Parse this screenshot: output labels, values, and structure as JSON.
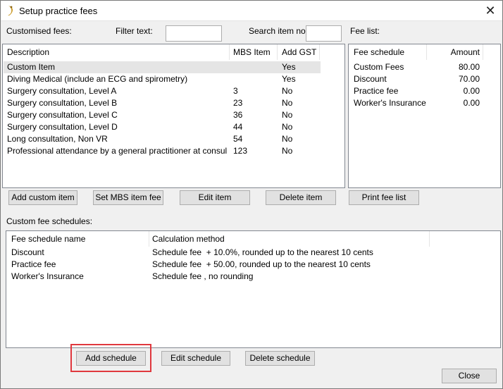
{
  "window": {
    "title": "Setup practice fees",
    "close_glyph": "✕",
    "icon": "practice-logo-icon"
  },
  "filters": {
    "customised_fees_label": "Customised fees:",
    "filter_text_label": "Filter text:",
    "filter_text_value": "",
    "search_item_label": "Search item no:",
    "search_item_value": "",
    "fee_list_label": "Fee list:"
  },
  "items_table": {
    "headers": {
      "description": "Description",
      "mbs_item": "MBS Item",
      "add_gst": "Add GST"
    },
    "rows": [
      {
        "description": "Custom Item",
        "mbs_item": "",
        "add_gst": "Yes"
      },
      {
        "description": "Diving Medical (include an ECG and spirometry)",
        "mbs_item": "",
        "add_gst": "Yes"
      },
      {
        "description": "Surgery consultation, Level A",
        "mbs_item": "3",
        "add_gst": "No"
      },
      {
        "description": "Surgery consultation, Level B",
        "mbs_item": "23",
        "add_gst": "No"
      },
      {
        "description": "Surgery consultation, Level C",
        "mbs_item": "36",
        "add_gst": "No"
      },
      {
        "description": "Surgery consultation, Level D",
        "mbs_item": "44",
        "add_gst": "No"
      },
      {
        "description": "Long consultation, Non VR",
        "mbs_item": "54",
        "add_gst": "No"
      },
      {
        "description": "Professional attendance by a general practitioner at consulting r...",
        "mbs_item": "123",
        "add_gst": "No"
      }
    ]
  },
  "fee_table": {
    "headers": {
      "schedule": "Fee schedule",
      "amount": "Amount"
    },
    "rows": [
      {
        "schedule": "Custom Fees",
        "amount": "80.00"
      },
      {
        "schedule": "Discount",
        "amount": "70.00"
      },
      {
        "schedule": "Practice fee",
        "amount": "0.00"
      },
      {
        "schedule": "Worker's Insurance",
        "amount": "0.00"
      }
    ]
  },
  "item_buttons": {
    "add_custom_item": "Add custom item",
    "set_mbs_item_fee": "Set MBS item fee",
    "edit_item": "Edit item",
    "delete_item": "Delete item",
    "print_fee_list": "Print fee list"
  },
  "schedules": {
    "label": "Custom fee schedules:",
    "headers": {
      "name": "Fee schedule name",
      "method": "Calculation method"
    },
    "rows": [
      {
        "name": "Discount",
        "method": "Schedule fee  + 10.0%, rounded up to the nearest 10 cents"
      },
      {
        "name": "Practice fee",
        "method": "Schedule fee  + 50.00, rounded up to the nearest 10 cents"
      },
      {
        "name": "Worker's Insurance",
        "method": "Schedule fee , no rounding"
      }
    ]
  },
  "schedule_buttons": {
    "add_schedule": "Add schedule",
    "edit_schedule": "Edit schedule",
    "delete_schedule": "Delete schedule"
  },
  "footer": {
    "close": "Close"
  },
  "colors": {
    "highlight": "#e0383e",
    "selected_row": "#e5e5e5"
  }
}
